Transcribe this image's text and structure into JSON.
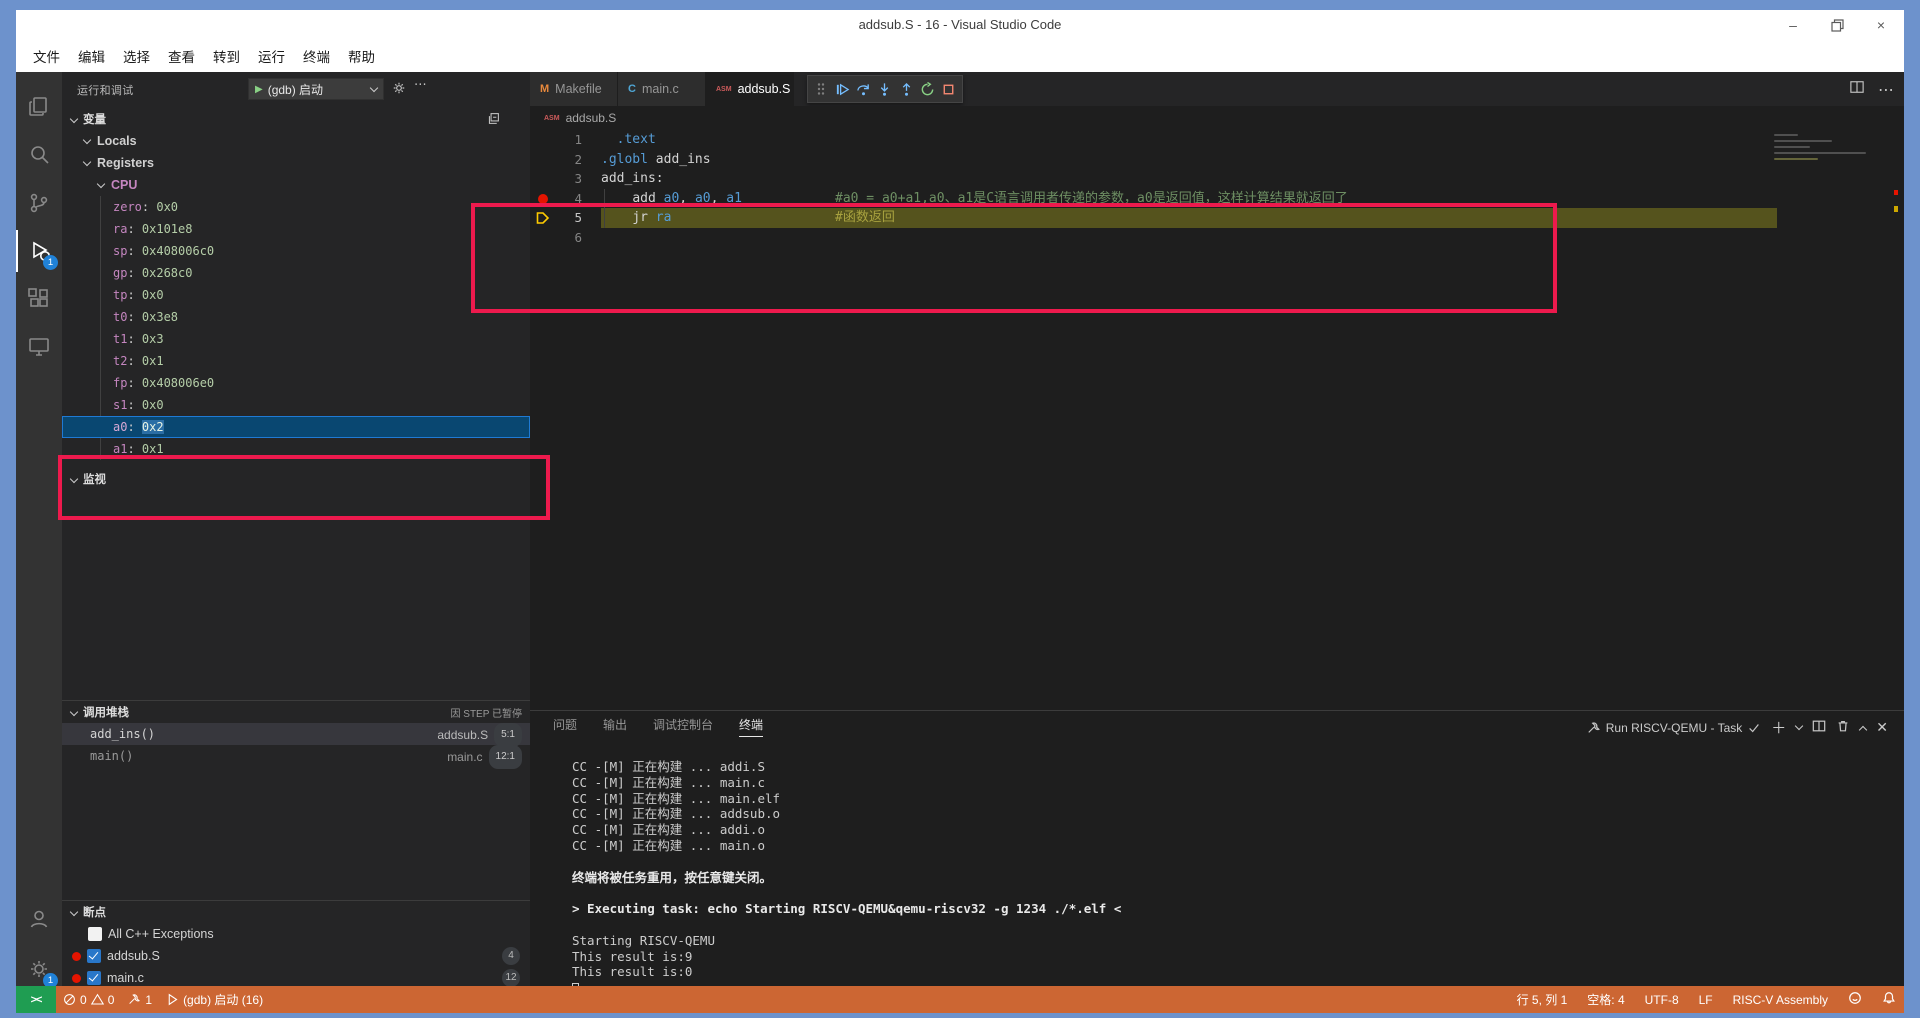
{
  "window": {
    "title": "addsub.S - 16 - Visual Studio Code"
  },
  "menubar": [
    "文件",
    "编辑",
    "选择",
    "查看",
    "转到",
    "运行",
    "终端",
    "帮助"
  ],
  "activity_bar": {
    "debug_badge": "1",
    "settings_badge": "1"
  },
  "debug_panel": {
    "header": "运行和调试",
    "launch_config": "(gdb) 启动",
    "variables_label": "变量",
    "locals_label": "Locals",
    "registers_label": "Registers",
    "cpu_label": "CPU",
    "registers": [
      {
        "name": "zero",
        "value": "0x0"
      },
      {
        "name": "ra",
        "value": "0x101e8"
      },
      {
        "name": "sp",
        "value": "0x408006c0"
      },
      {
        "name": "gp",
        "value": "0x268c0"
      },
      {
        "name": "tp",
        "value": "0x0"
      },
      {
        "name": "t0",
        "value": "0x3e8"
      },
      {
        "name": "t1",
        "value": "0x3"
      },
      {
        "name": "t2",
        "value": "0x1"
      },
      {
        "name": "fp",
        "value": "0x408006e0"
      },
      {
        "name": "s1",
        "value": "0x0"
      },
      {
        "name": "a0",
        "value": "0x2",
        "selected": true
      },
      {
        "name": "a1",
        "value": "0x1"
      }
    ],
    "watch_label": "监视",
    "call_stack": {
      "label": "调用堆栈",
      "status": "因 STEP 已暂停",
      "frames": [
        {
          "fn": "add_ins()",
          "file": "addsub.S",
          "pos": "5:1"
        },
        {
          "fn": "main()",
          "file": "main.c",
          "pos": "12:1"
        }
      ]
    },
    "breakpoints": {
      "label": "断点",
      "items": [
        {
          "label": "All C++ Exceptions",
          "checked": false,
          "dot": false,
          "count": ""
        },
        {
          "label": "addsub.S",
          "checked": true,
          "dot": true,
          "count": "4"
        },
        {
          "label": "main.c",
          "checked": true,
          "dot": true,
          "count": "12"
        }
      ]
    }
  },
  "editor": {
    "tabs": [
      {
        "label": "Makefile",
        "icon": "M",
        "icon_color": "#e8893c",
        "active": false
      },
      {
        "label": "main.c",
        "icon": "C",
        "icon_color": "#4fa6d5",
        "active": false
      },
      {
        "label": "addsub.S",
        "icon": "ASM",
        "icon_color": "#cc5b5b",
        "active": true
      }
    ],
    "breadcrumb": "addsub.S",
    "code": [
      {
        "num": "1",
        "gutter": "",
        "highlight": false,
        "tokens": [
          [
            "  ",
            "p"
          ],
          [
            ".text",
            "d"
          ]
        ],
        "comment": "",
        "comment_class": ""
      },
      {
        "num": "2",
        "gutter": "",
        "highlight": false,
        "tokens": [
          [
            ".globl",
            "d"
          ],
          [
            " add_ins",
            "p"
          ]
        ],
        "comment": "",
        "comment_class": ""
      },
      {
        "num": "3",
        "gutter": "",
        "highlight": false,
        "tokens": [
          [
            "add_ins:",
            "p"
          ]
        ],
        "comment": "",
        "comment_class": ""
      },
      {
        "num": "4",
        "gutter": "breakpoint",
        "highlight": false,
        "tokens": [
          [
            "    ",
            "p"
          ],
          [
            "add ",
            "p"
          ],
          [
            "a0",
            "r"
          ],
          [
            ", ",
            "p"
          ],
          [
            "a0",
            "r"
          ],
          [
            ", ",
            "p"
          ],
          [
            "a1",
            "r"
          ]
        ],
        "comment": "#a0 = a0+a1,a0、a1是C语言调用者传递的参数，a0是返回值，这样计算结果就返回了",
        "comment_class": "c"
      },
      {
        "num": "5",
        "gutter": "arrow",
        "highlight": true,
        "tokens": [
          [
            "    ",
            "p"
          ],
          [
            "jr ",
            "p"
          ],
          [
            "ra",
            "r"
          ]
        ],
        "comment": "#函数返回",
        "comment_class": "c5"
      },
      {
        "num": "6",
        "gutter": "",
        "highlight": false,
        "tokens": [],
        "comment": "",
        "comment_class": ""
      }
    ]
  },
  "panel": {
    "tabs": [
      "问题",
      "输出",
      "调试控制台",
      "终端"
    ],
    "active_tab": "终端",
    "task_label": "Run RISCV-QEMU - Task",
    "terminal": [
      {
        "text": "CC -[M] 正在构建 ... addi.S",
        "bold": false
      },
      {
        "text": "CC -[M] 正在构建 ... main.c",
        "bold": false
      },
      {
        "text": "CC -[M] 正在构建 ... main.elf",
        "bold": false
      },
      {
        "text": "CC -[M] 正在构建 ... addsub.o",
        "bold": false
      },
      {
        "text": "CC -[M] 正在构建 ... addi.o",
        "bold": false
      },
      {
        "text": "CC -[M] 正在构建 ... main.o",
        "bold": false
      },
      {
        "text": "",
        "bold": false
      },
      {
        "text": "终端将被任务重用，按任意键关闭。",
        "bold": true
      },
      {
        "text": "",
        "bold": false
      },
      {
        "text": "> Executing task: echo Starting RISCV-QEMU&qemu-riscv32 -g 1234 ./*.elf <",
        "bold": true
      },
      {
        "text": "",
        "bold": false
      },
      {
        "text": "Starting RISCV-QEMU",
        "bold": false
      },
      {
        "text": "This result is:9",
        "bold": false
      },
      {
        "text": "This result is:0",
        "bold": false
      }
    ]
  },
  "status_bar": {
    "errors": "0",
    "warnings": "0",
    "tasks": "1",
    "debug_status": "(gdb) 启动 (16)",
    "line_col": "行 5, 列 1",
    "indent": "空格: 4",
    "encoding": "UTF-8",
    "eol": "LF",
    "language": "RISC-V Assembly"
  },
  "colors": {
    "status_bar_debugging": "#cc6633",
    "annotation_red": "#ed1a4d",
    "selection_blue": "#094771",
    "debug_line_highlight": "#55531d",
    "remote_green": "#1f9d52",
    "breakpoint_red": "#e51400"
  }
}
